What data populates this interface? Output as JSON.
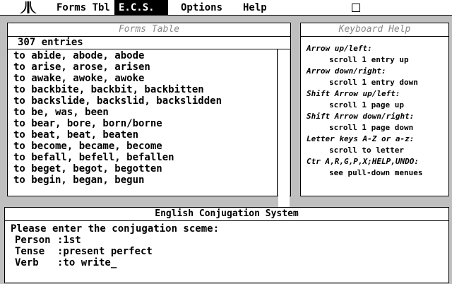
{
  "menubar": {
    "items": [
      {
        "label": "Forms Tbl"
      },
      {
        "label": "E.C.S."
      },
      {
        "label": "Options"
      },
      {
        "label": "Help"
      }
    ]
  },
  "forms_window": {
    "title": "Forms Table",
    "entry_count": "307 entries",
    "rows": [
      "to abide, abode, abode",
      "to arise, arose, arisen",
      "to awake, awoke, awoke",
      "to backbite, backbit, backbitten",
      "to backslide, backslid, backslidden",
      "to be, was, been",
      "to bear, bore, born/borne",
      "to beat, beat, beaten",
      "to become, became, become",
      "to befall, befell, befallen",
      "to beget, begot, begotten",
      "to begin, began, begun"
    ]
  },
  "help_window": {
    "title": "Keyboard Help",
    "entries": [
      {
        "key": "Arrow up/left:",
        "desc": "scroll 1 entry up"
      },
      {
        "key": "Arrow down/right:",
        "desc": "scroll 1 entry down"
      },
      {
        "key": "Shift Arrow up/left:",
        "desc": "scroll 1 page up"
      },
      {
        "key": "Shift Arrow down/right:",
        "desc": "scroll 1 page down"
      },
      {
        "key": "Letter keys A-Z or a-z:",
        "desc": "scroll to letter"
      },
      {
        "key": "Ctr A,R,G,P,X;HELP,UNDO:",
        "desc": "see pull-down menues"
      }
    ]
  },
  "ecs_window": {
    "title": "English Conjugation System",
    "prompt": "Please enter the conjugation sceme:",
    "person_label": "Person",
    "person_value": ":1st",
    "tense_label": "Tense",
    "tense_value": ":present perfect",
    "verb_label": "Verb",
    "verb_value": ":to write_"
  }
}
